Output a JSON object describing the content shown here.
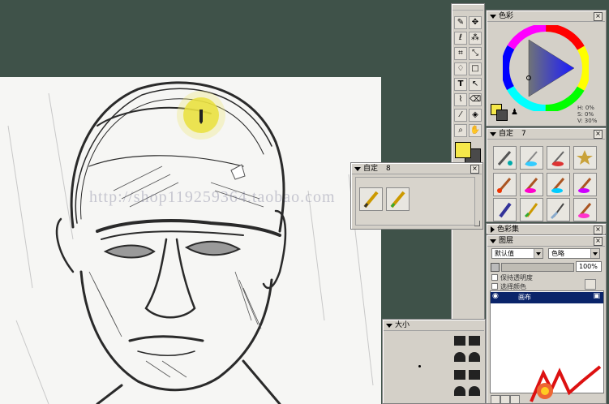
{
  "watermark": "http://shop119259364.taobao.com",
  "color_panel": {
    "title": "色彩",
    "readout_h": "H: 0%",
    "readout_s": "S: 0%",
    "readout_v": "V: 30%",
    "primary_color": "#f5e84a",
    "secondary_color": "#4a4a4a"
  },
  "custom_panel_main": {
    "title": "自定",
    "count": "7"
  },
  "custom_panel_float": {
    "title": "自定",
    "count": "8"
  },
  "color_set_panel": {
    "title": "色彩集"
  },
  "layers_panel": {
    "title": "图层",
    "blend_mode": "默认值",
    "blend_mode_2": "色略",
    "opacity": "100%",
    "option_1": "保持透明度",
    "option_2": "选择颜色",
    "layer_name": "画布"
  },
  "size_panel": {
    "title": "大小"
  },
  "toolbox": {
    "tools": [
      "brush-icon",
      "move-icon",
      "lasso-icon",
      "magic-wand-icon",
      "crop-icon",
      "transform-icon",
      "pen-icon",
      "rectangle-icon",
      "text-icon",
      "arrow-icon",
      "dropper-icon",
      "eraser-icon",
      "eyedropper-icon",
      "fill-icon",
      "zoom-icon",
      "hand-icon"
    ]
  }
}
